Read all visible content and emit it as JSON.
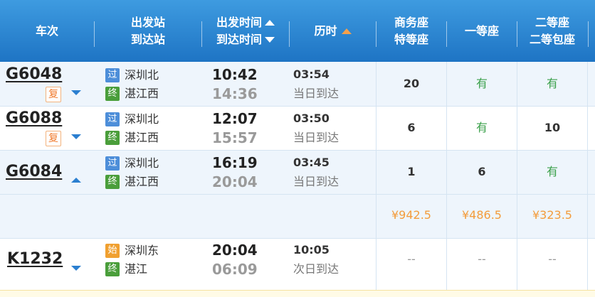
{
  "header": {
    "train_no": "车次",
    "station_top": "出发站",
    "station_bottom": "到达站",
    "time_top": "出发时间",
    "time_bottom": "到达时间",
    "duration": "历时",
    "business_top": "商务座",
    "business_bottom": "特等座",
    "first_class": "一等座",
    "second_top": "二等座",
    "second_bottom": "二等包座"
  },
  "badges": {
    "pass": "过",
    "terminal": "终",
    "start": "始",
    "return": "复"
  },
  "colors": {
    "header_top": "#3e9be0",
    "header_bottom": "#1e74c4",
    "available": "#3aa04a",
    "price": "#f39c3c",
    "accent": "#2b7fd0"
  },
  "trains": [
    {
      "train_no": "G6048",
      "has_return": true,
      "expanded": false,
      "from_badge": "过",
      "from": "深圳北",
      "to_badge": "终",
      "to": "湛江西",
      "depart": "10:42",
      "arrive": "14:36",
      "duration": "03:54",
      "arrive_day": "当日到达",
      "business": "20",
      "first": "有",
      "second": "有"
    },
    {
      "train_no": "G6088",
      "has_return": true,
      "expanded": false,
      "from_badge": "过",
      "from": "深圳北",
      "to_badge": "终",
      "to": "湛江西",
      "depart": "12:07",
      "arrive": "15:57",
      "duration": "03:50",
      "arrive_day": "当日到达",
      "business": "6",
      "first": "有",
      "second": "10"
    },
    {
      "train_no": "G6084",
      "has_return": false,
      "expanded": true,
      "from_badge": "过",
      "from": "深圳北",
      "to_badge": "终",
      "to": "湛江西",
      "depart": "16:19",
      "arrive": "20:04",
      "duration": "03:45",
      "arrive_day": "当日到达",
      "business": "1",
      "first": "6",
      "second": "有"
    },
    {
      "train_no": "K1232",
      "has_return": false,
      "expanded": false,
      "from_badge": "始",
      "from": "深圳东",
      "to_badge": "终",
      "to": "湛江",
      "depart": "20:04",
      "arrive": "06:09",
      "duration": "10:05",
      "arrive_day": "次日到达",
      "business": "--",
      "first": "--",
      "second": "--"
    }
  ],
  "prices_g6084": {
    "business": "¥942.5",
    "first": "¥486.5",
    "second": "¥323.5"
  }
}
